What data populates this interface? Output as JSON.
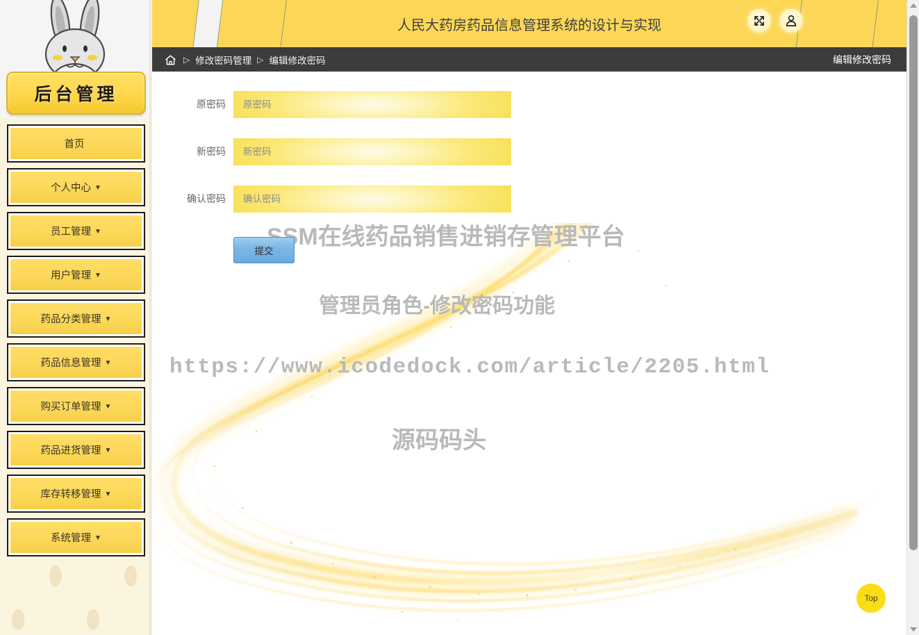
{
  "brand": {
    "plate_label": "后台管理",
    "mascot": "rabbit-mascot"
  },
  "sidebar": {
    "items": [
      {
        "label": "首页",
        "caret": ""
      },
      {
        "label": "个人中心",
        "caret": "▼"
      },
      {
        "label": "员工管理",
        "caret": "▼"
      },
      {
        "label": "用户管理",
        "caret": "▼"
      },
      {
        "label": "药品分类管理",
        "caret": "▼"
      },
      {
        "label": "药品信息管理",
        "caret": "▼"
      },
      {
        "label": "购买订单管理",
        "caret": "▼"
      },
      {
        "label": "药品进货管理",
        "caret": "▼"
      },
      {
        "label": "库存转移管理",
        "caret": "▼"
      },
      {
        "label": "系统管理",
        "caret": "▼"
      }
    ]
  },
  "header": {
    "title": "人民大药房药品信息管理系统的设计与实现",
    "fullscreen_icon": "fullscreen-icon",
    "user_icon": "user-icon"
  },
  "breadcrumb": {
    "home_icon": "home-icon",
    "separator": "▷",
    "item1": "修改密码管理",
    "item2": "编辑修改密码",
    "page_title": "编辑修改密码"
  },
  "form": {
    "rows": [
      {
        "label": "原密码",
        "placeholder": "原密码",
        "value": ""
      },
      {
        "label": "新密码",
        "placeholder": "新密码",
        "value": ""
      },
      {
        "label": "确认密码",
        "placeholder": "确认密码",
        "value": ""
      }
    ],
    "submit_label": "提交"
  },
  "watermarks": {
    "title": "SSM在线药品销售进销存管理平台",
    "role": "管理员角色-修改密码功能",
    "url": "https://www.icodedock.com/article/2205.html",
    "brand": "源码码头"
  },
  "top_button": {
    "label": "Top"
  },
  "colors": {
    "accent_yellow": "#fcd757",
    "sidebar_bg": "#fbf4df",
    "breadcrumb_bg": "#3c3c3c",
    "submit_blue": "#7ab7e6",
    "top_button": "#fbdd13"
  }
}
